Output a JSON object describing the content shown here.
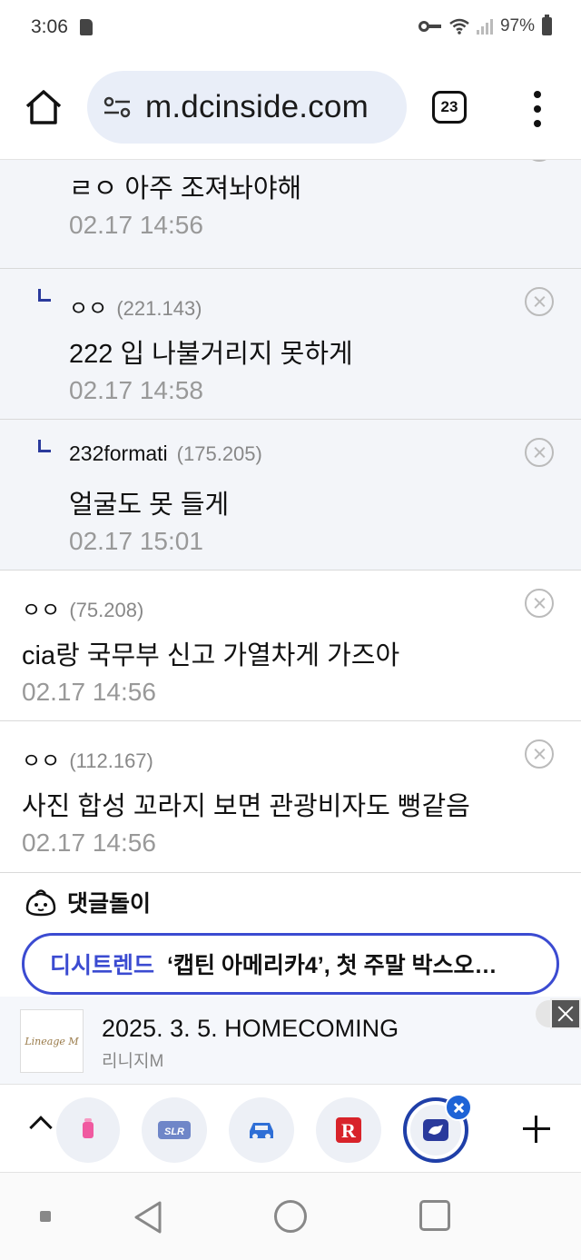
{
  "status_bar": {
    "time": "3:06",
    "battery": "97%"
  },
  "browser": {
    "url": "m.dcinside.com",
    "tab_count": "23"
  },
  "comments": [
    {
      "nick": "",
      "ip": "",
      "body": "ㄹㅇ 아주 조져놔야해",
      "date": "02.17 14:56",
      "reply": true,
      "partial_top": true
    },
    {
      "nick": "ㅇㅇ",
      "ip": "(221.143)",
      "body": "222 입 나불거리지 못하게",
      "date": "02.17 14:58",
      "reply": true
    },
    {
      "nick": "232formati",
      "ip": "(175.205)",
      "body": "얼굴도 못 들게",
      "date": "02.17 15:01",
      "reply": true
    },
    {
      "nick": "ㅇㅇ",
      "ip": "(75.208)",
      "body": "cia랑 국무부 신고 가열차게 가즈아",
      "date": "02.17 14:56",
      "reply": false
    },
    {
      "nick": "ㅇㅇ",
      "ip": "(112.167)",
      "body": "사진 합성 꼬라지 보면 관광비자도 뻥같음",
      "date": "02.17 14:56",
      "reply": false
    }
  ],
  "comment_bot": {
    "title": "댓글돌이"
  },
  "trend": {
    "label": "디시트렌드",
    "text": "‘캡틴 아메리카4’, 첫 주말 박스오…"
  },
  "ad": {
    "logo_text": "Lineage M",
    "title": "2025. 3. 5. HOMECOMING",
    "subtitle": "리니지M"
  },
  "quick_bar": {
    "icons": [
      "app-pink-icon",
      "slr-icon",
      "car-icon",
      "r-icon",
      "gallery-icon"
    ]
  },
  "colors": {
    "accent": "#3b4bd1",
    "reply_bg": "#f3f5f9",
    "badge": "#1e63d6"
  }
}
